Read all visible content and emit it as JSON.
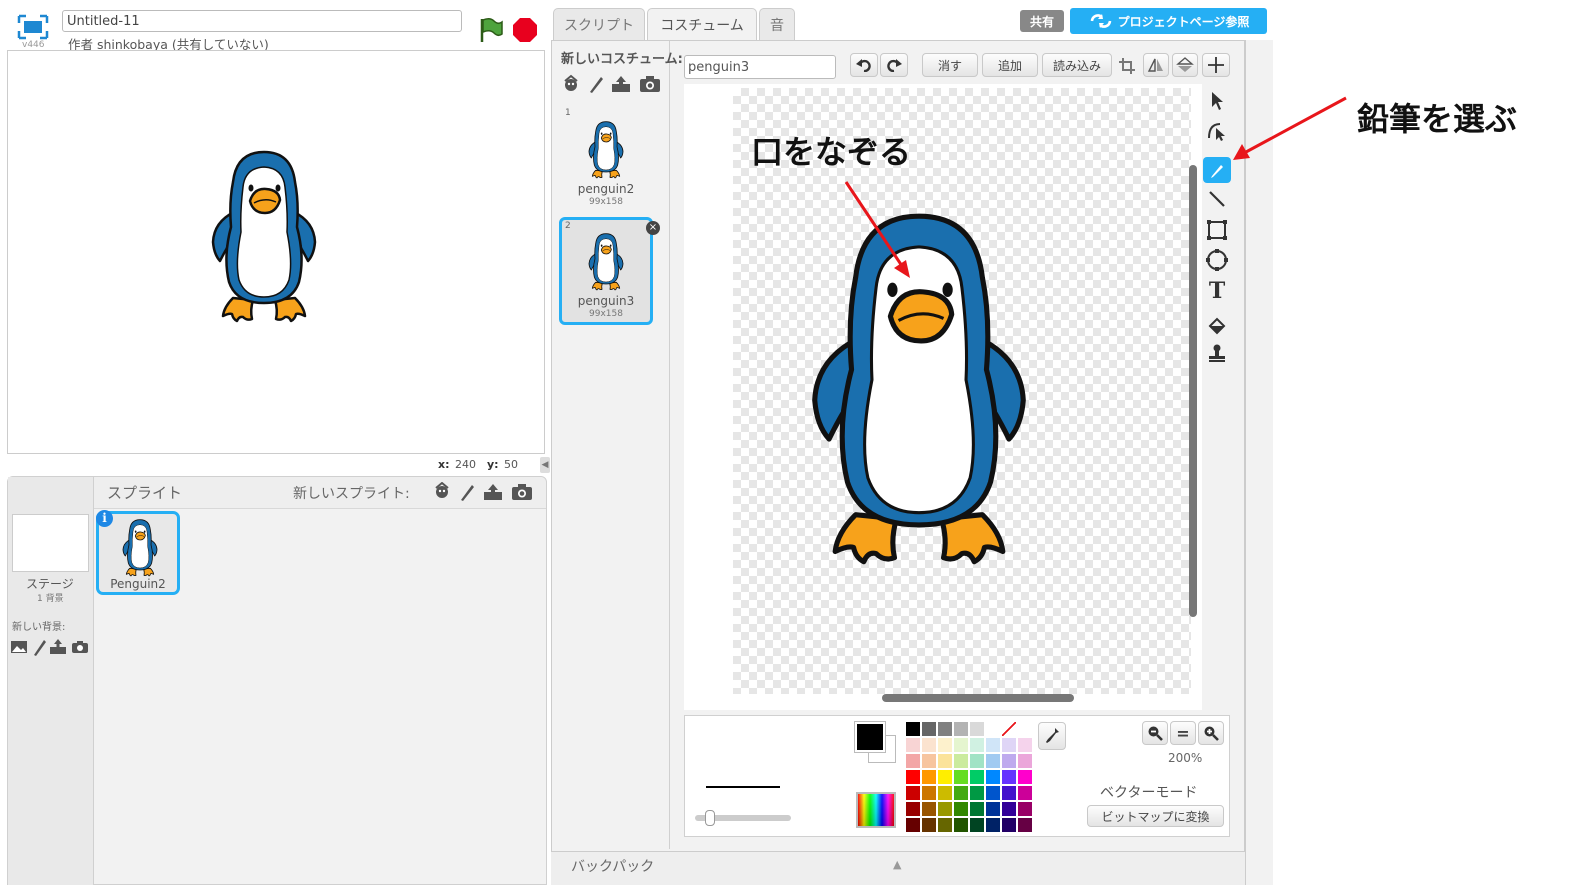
{
  "project": {
    "title_value": "Untitled-11",
    "version": "v446",
    "author_line": "作者 shinkobaya (共有していない)"
  },
  "stage": {
    "coords_x_label": "x:",
    "coords_x_value": "240",
    "coords_y_label": "y:",
    "coords_y_value": "50"
  },
  "sprites_pane": {
    "header": "スプライト",
    "new_sprite_label": "新しいスプライト:",
    "stage_label": "ステージ",
    "stage_backdrops": "1 背景",
    "new_backdrop_label": "新しい背景:",
    "sprites": [
      {
        "name": "Penguin2"
      }
    ]
  },
  "tabs": [
    {
      "label": "スクリプト"
    },
    {
      "label": "コスチューム"
    },
    {
      "label": "音"
    }
  ],
  "top_right": {
    "share_label": "共有",
    "project_page_label": "プロジェクトページ参照"
  },
  "costumes_pane": {
    "new_costume_label": "新しいコスチューム:",
    "items": [
      {
        "index": "1",
        "name": "penguin2",
        "size": "99x158"
      },
      {
        "index": "2",
        "name": "penguin3",
        "size": "99x158"
      }
    ],
    "selected_index": 2
  },
  "editor": {
    "costume_name_value": "penguin3",
    "clear_label": "消す",
    "add_label": "追加",
    "import_label": "読み込み",
    "zoom_level": "200%",
    "mode_label": "ベクターモード",
    "convert_label": "ビットマップに変換",
    "current_color": "#000000",
    "tools": [
      "select-tool",
      "reshape-tool",
      "pencil-tool",
      "line-tool",
      "rectangle-tool",
      "ellipse-tool",
      "text-tool",
      "fill-tool",
      "duplicate-tool"
    ],
    "selected_tool": "pencil-tool"
  },
  "palette": [
    [
      "#000000",
      "#666666",
      "#808080",
      "#b3b3b3",
      "#d9d9d9",
      "#ffffff",
      "transparent"
    ],
    [
      "#f8d4d4",
      "#fbe3cf",
      "#fdf1cc",
      "#e5f5cf",
      "#d0f1e2",
      "#d0e5f8",
      "#dfd5f6",
      "#f5d3ec"
    ],
    [
      "#f3a6a6",
      "#f7c59f",
      "#fbe39a",
      "#cbeb9e",
      "#a1e3c5",
      "#a1caf1",
      "#bfaaee",
      "#eba6da"
    ],
    [
      "#ff0000",
      "#ff9900",
      "#ffee00",
      "#66dd22",
      "#00cc66",
      "#0088ff",
      "#6633ff",
      "#ff00cc"
    ],
    [
      "#cc0000",
      "#cc7700",
      "#ccbb00",
      "#44aa11",
      "#009944",
      "#0055cc",
      "#4411cc",
      "#cc0099"
    ],
    [
      "#990000",
      "#995500",
      "#999900",
      "#338800",
      "#007733",
      "#003399",
      "#330099",
      "#990066"
    ],
    [
      "#660000",
      "#663300",
      "#666600",
      "#225500",
      "#004422",
      "#002266",
      "#220066",
      "#660044"
    ]
  ],
  "backpack": {
    "label": "バックパック"
  },
  "annotations": {
    "trace_mouth": "口をなぞる",
    "choose_pencil": "鉛筆を選ぶ"
  },
  "colors": {
    "accent": "#25aff4",
    "arrow": "#e8161b",
    "penguin_blue": "#1a6fae",
    "beak": "#f7a21b"
  }
}
